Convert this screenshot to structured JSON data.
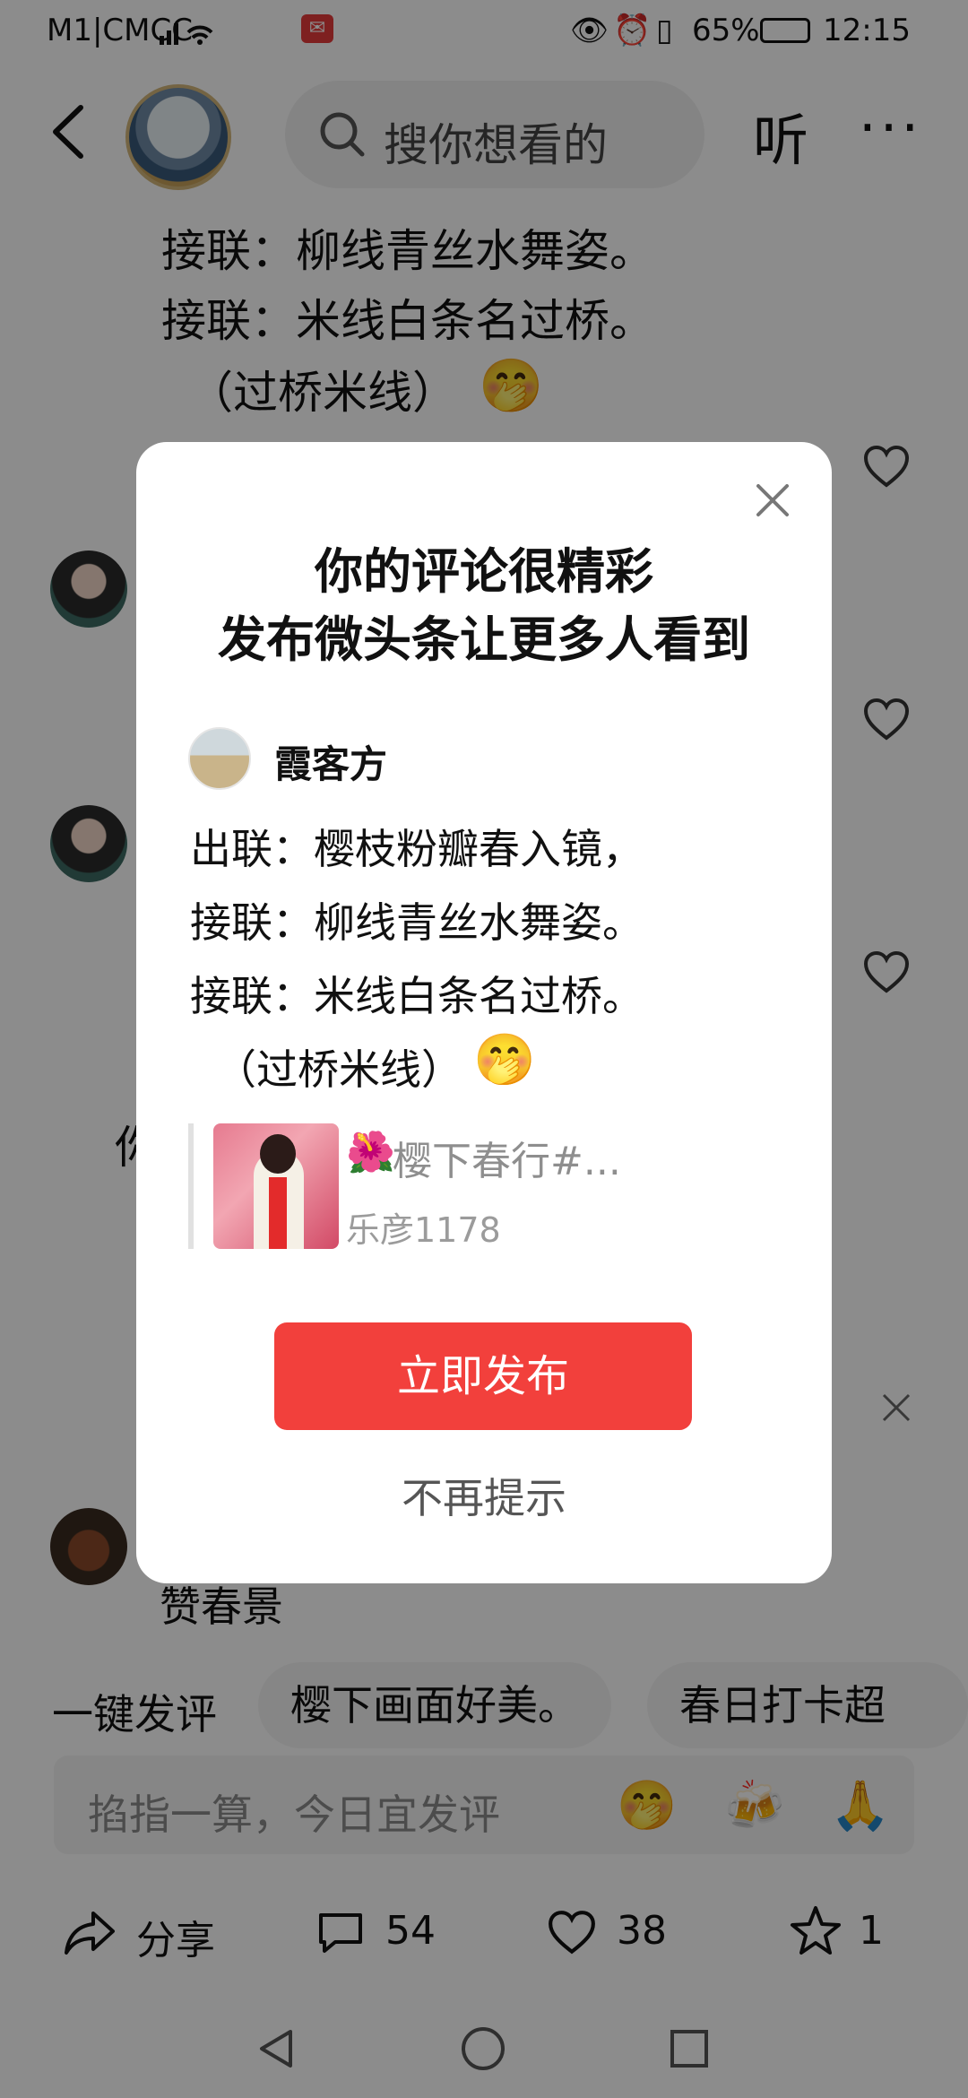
{
  "status_bar": {
    "carrier": "M1|CMCC",
    "battery": "65%",
    "time": "12:15"
  },
  "header": {
    "search_placeholder": "搜你想看的",
    "listen_label": "听",
    "more_label": "···"
  },
  "post": {
    "lines": [
      "接联：柳线青丝水舞姿。",
      "接联：米线白条名过桥。",
      "（过桥米线）"
    ]
  },
  "comments": {
    "partial_text": "你",
    "last_comment_text": "赞春景"
  },
  "quick_reply": {
    "label": "一键发评",
    "chips": [
      "樱下画面好美。",
      "春日打卡超棒。"
    ]
  },
  "input": {
    "placeholder": "掐指一算，今日宜发评"
  },
  "actions": {
    "share_label": "分享",
    "comment_count": "54",
    "like_count": "38",
    "favorite_count": "1"
  },
  "modal": {
    "title_line1": "你的评论很精彩",
    "title_line2": "发布微头条让更多人看到",
    "user_name": "霞客方",
    "lines": [
      "出联：樱枝粉瓣春入镜，",
      "接联：柳线青丝水舞姿。",
      "接联：米线白条名过桥。",
      "（过桥米线）"
    ],
    "quote_title": "樱下春行#...",
    "quote_author": "乐彦1178",
    "publish_label": "立即发布",
    "no_remind_label": "不再提示"
  },
  "colors": {
    "accent": "#f2403c",
    "overlay": "rgba(0,0,0,0.45)"
  }
}
